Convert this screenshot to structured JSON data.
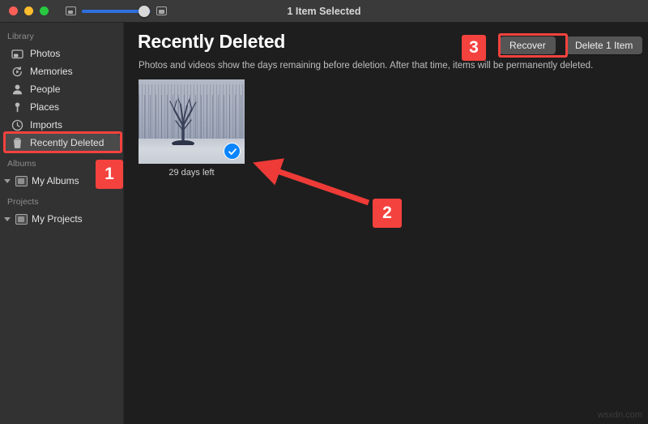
{
  "window": {
    "title": "1 Item Selected",
    "traffic_lights": [
      "close",
      "minimize",
      "maximize"
    ],
    "zoom_slider": {
      "min_icon": "small-photo-icon",
      "max_icon": "large-photo-icon",
      "value_pct": 82
    }
  },
  "sidebar": {
    "sections": [
      {
        "header": "Library",
        "items": [
          {
            "label": "Photos",
            "icon": "photos-icon",
            "selected": false
          },
          {
            "label": "Memories",
            "icon": "memories-icon",
            "selected": false
          },
          {
            "label": "People",
            "icon": "people-icon",
            "selected": false
          },
          {
            "label": "Places",
            "icon": "places-pin-icon",
            "selected": false
          },
          {
            "label": "Imports",
            "icon": "imports-clock-icon",
            "selected": false
          },
          {
            "label": "Recently Deleted",
            "icon": "trash-icon",
            "selected": true
          }
        ]
      },
      {
        "header": "Albums",
        "items": [
          {
            "label": "My Albums",
            "icon": "folder-icon",
            "selected": false
          }
        ]
      },
      {
        "header": "Projects",
        "items": [
          {
            "label": "My Projects",
            "icon": "folder-icon",
            "selected": false
          }
        ]
      }
    ]
  },
  "main": {
    "title": "Recently Deleted",
    "subtitle": "Photos and videos show the days remaining before deletion. After that time, items will be permanently deleted.",
    "buttons": {
      "recover": "Recover",
      "delete": "Delete 1 Item"
    },
    "items": [
      {
        "caption": "29 days left",
        "selected": true,
        "image_alt": "bare tree in snowy winter field"
      }
    ]
  },
  "annotations": {
    "badges": [
      {
        "number": "1",
        "target": "sidebar-recently-deleted"
      },
      {
        "number": "2",
        "target": "photo-selection-checkmark"
      },
      {
        "number": "3",
        "target": "recover-button"
      }
    ],
    "arrow": {
      "from": "badge-2",
      "to": "photo-selection-checkmark"
    },
    "highlight_color": "#f4423e"
  },
  "watermark": "wsxdn.com"
}
